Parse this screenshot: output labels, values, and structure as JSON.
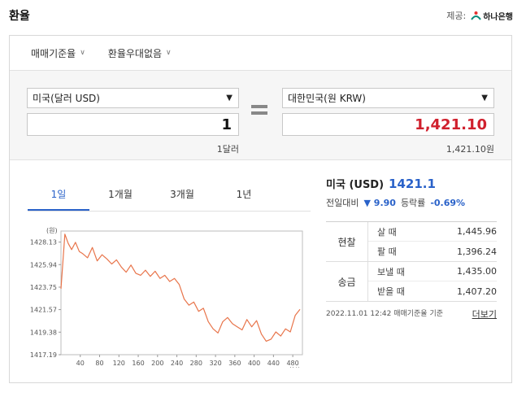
{
  "header": {
    "title": "환율",
    "provider_label": "제공:",
    "provider_name": "하나은행"
  },
  "settings": {
    "basis": "매매기준율",
    "preference": "환율우대없음"
  },
  "converter": {
    "from": {
      "currency": "미국(달러 USD)",
      "amount": "1",
      "subtext": "1달러"
    },
    "to": {
      "currency": "대한민국(원 KRW)",
      "amount": "1,421.10",
      "subtext": "1,421.10원"
    }
  },
  "tabs": [
    "1일",
    "1개월",
    "3개월",
    "1년"
  ],
  "info": {
    "country": "미국 (USD)",
    "rate": "1421.1",
    "change_label": "전일대비",
    "change_value": "9.90",
    "change_rate_label": "등락률",
    "change_pct": "-0.69%"
  },
  "table": {
    "cash": {
      "name": "현찰",
      "rows": [
        {
          "label": "살 때",
          "value": "1,445.96"
        },
        {
          "label": "팔 때",
          "value": "1,396.24"
        }
      ]
    },
    "transfer": {
      "name": "송금",
      "rows": [
        {
          "label": "보낼 때",
          "value": "1,435.00"
        },
        {
          "label": "받을 때",
          "value": "1,407.20"
        }
      ]
    }
  },
  "footer": {
    "timestamp": "2022.11.01 12:42 매매기준율 기준",
    "more": "더보기"
  },
  "colors": {
    "accent": "#2a62c9",
    "line": "#e8744a",
    "red": "#d0202d"
  },
  "chart_data": {
    "type": "line",
    "y_unit_label": "(원)",
    "x_unit_label": "(회차)",
    "x_ticks": [
      40,
      80,
      120,
      160,
      200,
      240,
      280,
      320,
      360,
      400,
      440,
      480
    ],
    "y_ticks": [
      "1428.13",
      "1425.94",
      "1423.75",
      "1421.57",
      "1419.38",
      "1417.19"
    ],
    "xlim": [
      0,
      500
    ],
    "ylim": [
      1417.19,
      1429.2
    ],
    "series": [
      {
        "x": [
          0,
          8,
          15,
          22,
          30,
          38,
          45,
          55,
          65,
          75,
          85,
          95,
          105,
          115,
          125,
          135,
          145,
          155,
          165,
          175,
          185,
          195,
          205,
          215,
          225,
          235,
          245,
          255,
          265,
          275,
          285,
          295,
          305,
          315,
          325,
          335,
          345,
          355,
          365,
          375,
          385,
          395,
          405,
          415,
          425,
          435,
          445,
          455,
          465,
          475,
          485,
          495
        ],
        "values": [
          1423.6,
          1428.9,
          1428.0,
          1427.4,
          1428.1,
          1427.2,
          1427.0,
          1426.6,
          1427.6,
          1426.3,
          1426.9,
          1426.5,
          1426.0,
          1426.4,
          1425.7,
          1425.2,
          1425.9,
          1425.1,
          1424.9,
          1425.4,
          1424.8,
          1425.3,
          1424.6,
          1424.9,
          1424.3,
          1424.6,
          1424.0,
          1422.6,
          1422.0,
          1422.3,
          1421.4,
          1421.7,
          1420.4,
          1419.7,
          1419.3,
          1420.4,
          1420.8,
          1420.2,
          1419.9,
          1419.6,
          1420.6,
          1419.9,
          1420.5,
          1419.2,
          1418.5,
          1418.7,
          1419.4,
          1419.0,
          1419.7,
          1419.4,
          1421.0,
          1421.6
        ]
      }
    ]
  }
}
